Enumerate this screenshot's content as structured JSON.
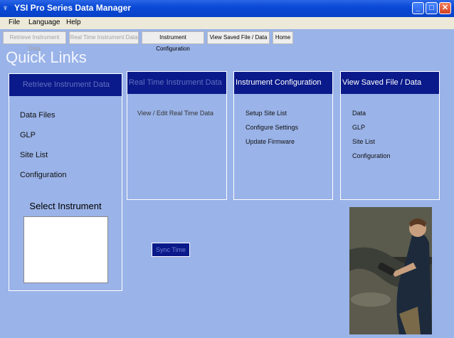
{
  "window": {
    "title": "YSI Pro Series Data Manager",
    "minimize": "_",
    "maximize": "□",
    "close": "✕"
  },
  "menu": [
    "File",
    "Language",
    "Help"
  ],
  "tabs": [
    "Retrieve Instrument Data",
    "Real Time Instrument Data",
    "Instrument Configuration",
    "View Saved File / Data",
    "Home"
  ],
  "page_title": "Quick Links",
  "panels": [
    {
      "title": "Retrieve Instrument Data",
      "links": [
        "Data Files",
        "GLP",
        "Site List",
        "Configuration"
      ]
    },
    {
      "title": "Real Time Instrument Data",
      "links": [
        "View / Edit Real Time Data"
      ]
    },
    {
      "title": "Instrument Configuration",
      "links": [
        "Setup Site List",
        "Configure Settings",
        "Update Firmware"
      ]
    },
    {
      "title": "View Saved File / Data",
      "links": [
        "Data",
        "GLP",
        "Site List",
        "Configuration"
      ]
    }
  ],
  "select_instrument": "Select Instrument",
  "sync_button": "Sync Time"
}
